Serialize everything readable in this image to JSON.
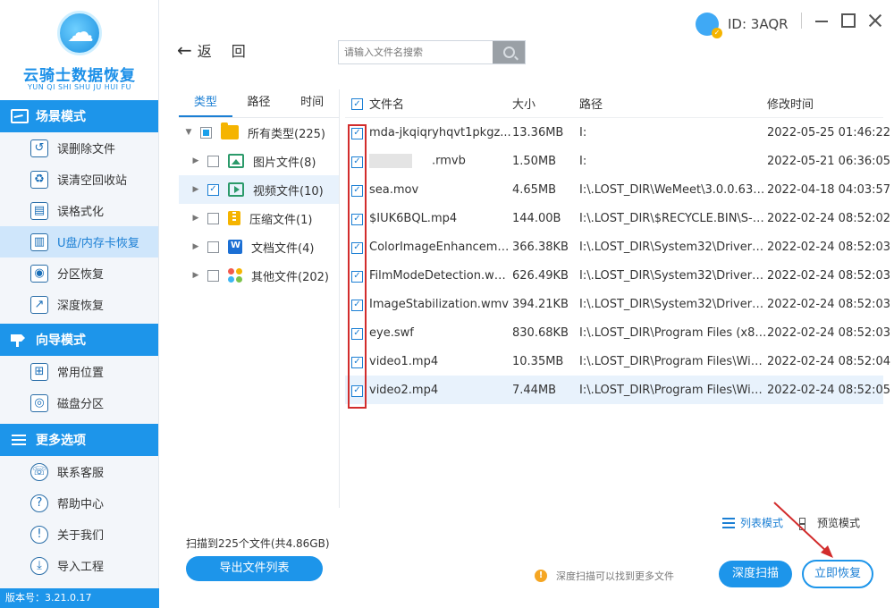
{
  "app": {
    "logo_title": "云骑士数据恢复",
    "logo_subtitle": "YUN QI SHI SHU JU HUI FU",
    "version": "版本号：3.21.0.17",
    "user_id": "ID: 3AQR"
  },
  "sidebar": {
    "sections": [
      {
        "title": "场景模式",
        "items": [
          {
            "label": "误删除文件",
            "icon": "trash-restore-icon"
          },
          {
            "label": "误清空回收站",
            "icon": "recycle-bin-icon"
          },
          {
            "label": "误格式化",
            "icon": "format-icon"
          },
          {
            "label": "U盘/内存卡恢复",
            "icon": "usb-card-icon",
            "active": true
          },
          {
            "label": "分区恢复",
            "icon": "partition-icon"
          },
          {
            "label": "深度恢复",
            "icon": "deep-recover-icon"
          }
        ]
      },
      {
        "title": "向导模式",
        "items": [
          {
            "label": "常用位置",
            "icon": "windows-icon"
          },
          {
            "label": "磁盘分区",
            "icon": "disk-icon"
          }
        ]
      },
      {
        "title": "更多选项",
        "items": [
          {
            "label": "联系客服",
            "icon": "phone-icon"
          },
          {
            "label": "帮助中心",
            "icon": "help-icon"
          },
          {
            "label": "关于我们",
            "icon": "info-icon"
          },
          {
            "label": "导入工程",
            "icon": "import-icon"
          }
        ]
      }
    ]
  },
  "toolbar": {
    "back_label": "返回",
    "search_placeholder": "请输入文件名搜索"
  },
  "tree": {
    "tabs": [
      "类型",
      "路径",
      "时间"
    ],
    "root": "所有类型(225)",
    "items": [
      {
        "label": "图片文件(8)",
        "icon": "image-icon",
        "checked": false
      },
      {
        "label": "视频文件(10)",
        "icon": "video-icon",
        "checked": true
      },
      {
        "label": "压缩文件(1)",
        "icon": "zip-icon",
        "checked": false
      },
      {
        "label": "文档文件(4)",
        "icon": "document-icon",
        "checked": false
      },
      {
        "label": "其他文件(202)",
        "icon": "other-icon",
        "checked": false
      }
    ]
  },
  "files": {
    "columns": {
      "name": "文件名",
      "size": "大小",
      "path": "路径",
      "mtime": "修改时间"
    },
    "rows": [
      {
        "name": "mda-jkqiqryhqvt1pkgz...",
        "size": "13.36MB",
        "path": "I:",
        "mtime": "2022-05-25 01:46:22"
      },
      {
        "name": ".rmvb",
        "size": "1.50MB",
        "path": "I:",
        "mtime": "2022-05-21 06:36:05",
        "redacted": true
      },
      {
        "name": "sea.mov",
        "size": "4.65MB",
        "path": "I:\\.LOST_DIR\\WeMeet\\3.0.0.630\\r...",
        "mtime": "2022-04-18 04:03:57"
      },
      {
        "name": "$IUK6BQL.mp4",
        "size": "144.00B",
        "path": "I:\\.LOST_DIR\\$RECYCLE.BIN\\S-1-...",
        "mtime": "2022-02-24 08:52:02"
      },
      {
        "name": "ColorImageEnhanceme...",
        "size": "366.38KB",
        "path": "I:\\.LOST_DIR\\System32\\DriverSto...",
        "mtime": "2022-02-24 08:52:03"
      },
      {
        "name": "FilmModeDetection.wmv",
        "size": "626.49KB",
        "path": "I:\\.LOST_DIR\\System32\\DriverSto...",
        "mtime": "2022-02-24 08:52:03"
      },
      {
        "name": "ImageStabilization.wmv",
        "size": "394.21KB",
        "path": "I:\\.LOST_DIR\\System32\\DriverSto...",
        "mtime": "2022-02-24 08:52:03"
      },
      {
        "name": "eye.swf",
        "size": "830.68KB",
        "path": "I:\\.LOST_DIR\\Program Files (x86)...",
        "mtime": "2022-02-24 08:52:03"
      },
      {
        "name": "video1.mp4",
        "size": "10.35MB",
        "path": "I:\\.LOST_DIR\\Program Files\\Wind...",
        "mtime": "2022-02-24 08:52:04"
      },
      {
        "name": "video2.mp4",
        "size": "7.44MB",
        "path": "I:\\.LOST_DIR\\Program Files\\Wind...",
        "mtime": "2022-02-24 08:52:05",
        "selected": true
      }
    ]
  },
  "footer": {
    "scan_summary": "扫描到225个文件(共4.86GB)",
    "export_label": "导出文件列表",
    "view_list": "列表模式",
    "view_preview": "预览模式",
    "hint": "深度扫描可以找到更多文件",
    "deep_scan_label": "深度扫描",
    "recover_label": "立即恢复"
  },
  "colors": {
    "accent": "#1d95ea",
    "highlight": "#d22c2c"
  }
}
